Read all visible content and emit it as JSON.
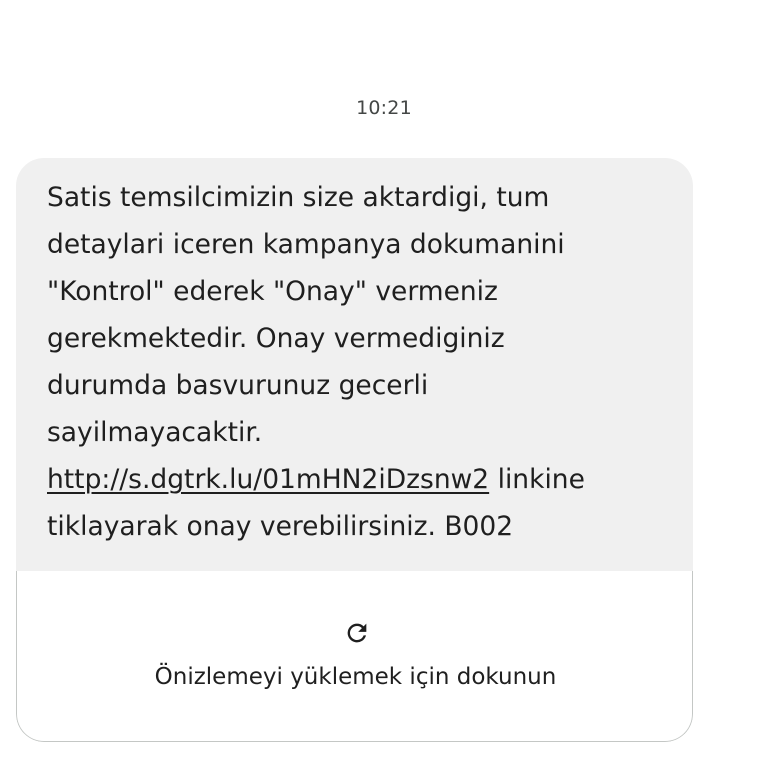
{
  "header": {
    "timestamp": "10:21"
  },
  "message": {
    "lines": [
      "Satis temsilcimizin size aktardigi, tum",
      "detaylari iceren kampanya dokumanini",
      "\"Kontrol\" ederek \"Onay\" vermeniz",
      "gerekmektedir. Onay vermediginiz",
      "durumda basvurunuz gecerli",
      "sayilmayacaktir."
    ],
    "link_text": "http://s.dgtrk.lu/01mHN2iDzsnw2",
    "link_suffix": " linkine",
    "last_line": "tiklayarak onay verebilirsiniz. B002",
    "colors": {
      "bubble_background": "#f0f0f0",
      "text": "#1f1f1f",
      "timestamp": "#444746",
      "card_border": "#c4c7c5"
    }
  },
  "preview": {
    "icon": "refresh-icon",
    "label": "Önizlemeyi yüklemek için dokunun"
  }
}
